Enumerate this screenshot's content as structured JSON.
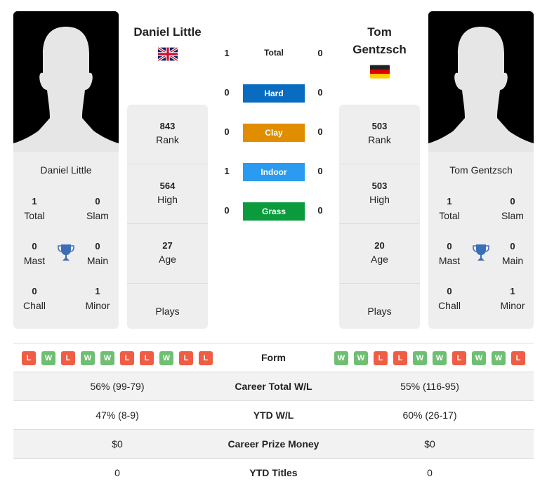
{
  "colors": {
    "hard": "#0a6cc1",
    "clay": "#e08d00",
    "indoor": "#2a9bf0",
    "grass": "#0b9a3c",
    "win": "#6fbf73",
    "loss": "#ee5d44",
    "trophy": "#3a6fb8"
  },
  "player1": {
    "name": "Daniel Little",
    "flag": "gb-flag",
    "titles": {
      "total": {
        "value": "1",
        "label": "Total"
      },
      "slam": {
        "value": "0",
        "label": "Slam"
      },
      "mast": {
        "value": "0",
        "label": "Mast"
      },
      "main": {
        "value": "0",
        "label": "Main"
      },
      "chall": {
        "value": "0",
        "label": "Chall"
      },
      "minor": {
        "value": "1",
        "label": "Minor"
      }
    },
    "stats": {
      "rank": {
        "value": "843",
        "label": "Rank"
      },
      "high": {
        "value": "564",
        "label": "High"
      },
      "age": {
        "value": "27",
        "label": "Age"
      },
      "plays": {
        "value": "",
        "label": "Plays"
      }
    },
    "form": [
      "L",
      "W",
      "L",
      "W",
      "W",
      "L",
      "L",
      "W",
      "L",
      "L"
    ]
  },
  "player2": {
    "name_line1": "Tom",
    "name_line2": "Gentzsch",
    "name": "Tom Gentzsch",
    "flag": "de-flag",
    "titles": {
      "total": {
        "value": "1",
        "label": "Total"
      },
      "slam": {
        "value": "0",
        "label": "Slam"
      },
      "mast": {
        "value": "0",
        "label": "Mast"
      },
      "main": {
        "value": "0",
        "label": "Main"
      },
      "chall": {
        "value": "0",
        "label": "Chall"
      },
      "minor": {
        "value": "1",
        "label": "Minor"
      }
    },
    "stats": {
      "rank": {
        "value": "503",
        "label": "Rank"
      },
      "high": {
        "value": "503",
        "label": "High"
      },
      "age": {
        "value": "20",
        "label": "Age"
      },
      "plays": {
        "value": "",
        "label": "Plays"
      }
    },
    "form": [
      "W",
      "W",
      "L",
      "L",
      "W",
      "W",
      "L",
      "W",
      "W",
      "L"
    ]
  },
  "h2h": {
    "total": {
      "label": "Total",
      "p1": "1",
      "p2": "0"
    },
    "surfaces": [
      {
        "key": "hard",
        "label": "Hard",
        "p1": "0",
        "p2": "0"
      },
      {
        "key": "clay",
        "label": "Clay",
        "p1": "0",
        "p2": "0"
      },
      {
        "key": "indoor",
        "label": "Indoor",
        "p1": "1",
        "p2": "0"
      },
      {
        "key": "grass",
        "label": "Grass",
        "p1": "0",
        "p2": "0"
      }
    ]
  },
  "comparison": {
    "form_label": "Form",
    "rows": [
      {
        "label": "Career Total W/L",
        "p1": "56% (99-79)",
        "p2": "55% (116-95)"
      },
      {
        "label": "YTD W/L",
        "p1": "47% (8-9)",
        "p2": "60% (26-17)"
      },
      {
        "label": "Career Prize Money",
        "p1": "$0",
        "p2": "$0"
      },
      {
        "label": "YTD Titles",
        "p1": "0",
        "p2": "0"
      }
    ]
  }
}
